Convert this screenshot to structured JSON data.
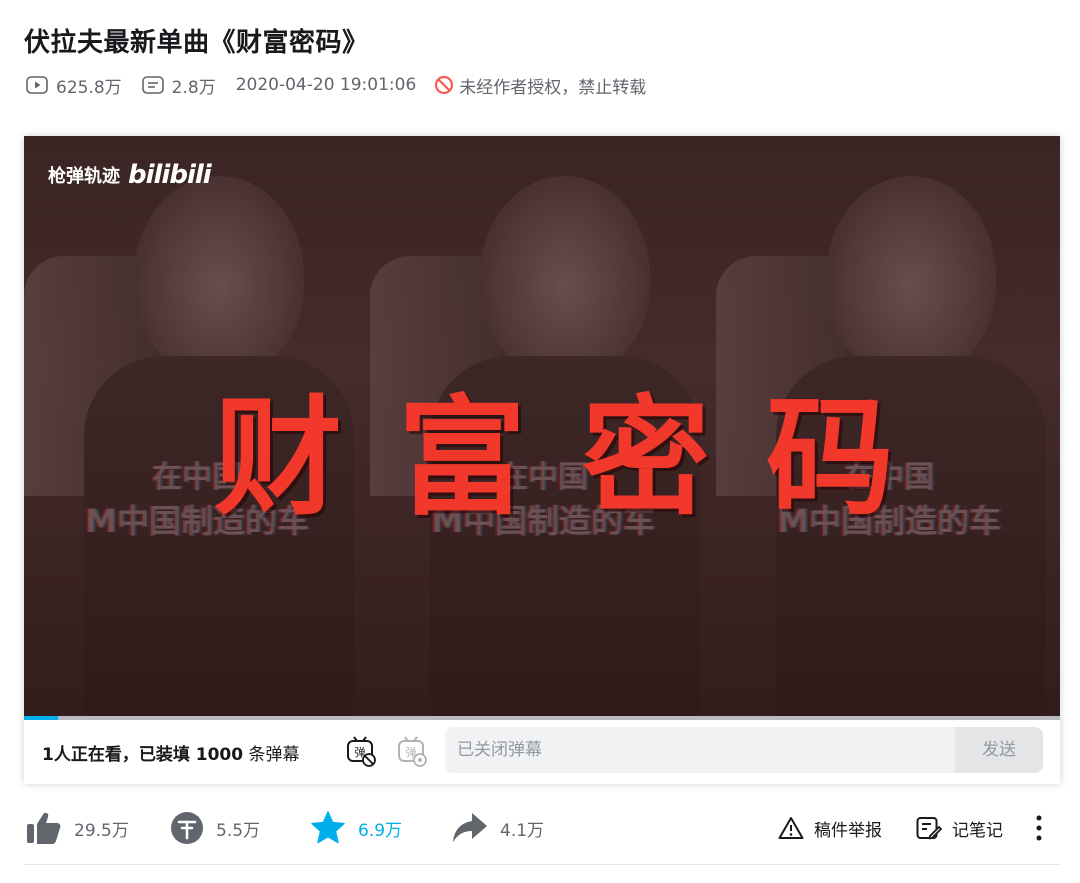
{
  "video": {
    "title": "伏拉夫最新单曲《财富密码》",
    "play_count": "625.8万",
    "danmaku_count": "2.8万",
    "publish_time": "2020-04-20 19:01:06",
    "copyright_notice": "未经作者授权，禁止转载"
  },
  "player": {
    "watermark_text": "枪弹轨迹",
    "watermark_logo": "bilibili",
    "overlay_title_chars": [
      "财",
      "富",
      "密",
      "码"
    ],
    "subtitle_line1": "在中国",
    "subtitle_line2": "M中国制造的车",
    "progress_fraction": 0.033
  },
  "danmaku_bar": {
    "viewers_prefix": "1人正在看，已装填 ",
    "loaded_count": "1000",
    "viewers_suffix": " 条弹幕",
    "input_placeholder": "已关闭弹幕",
    "send_label": "发送"
  },
  "toolbar": {
    "like_count": "29.5万",
    "coin_count": "5.5万",
    "favorite_count": "6.9万",
    "share_count": "4.1万",
    "report_label": "稿件举报",
    "note_label": "记笔记"
  },
  "colors": {
    "accent": "#00aeec",
    "title_red": "#f2372b",
    "muted_text": "#61666d",
    "forbid_red": "#f85a54"
  },
  "icons": {
    "play": "play-count-icon",
    "danmaku": "danmaku-count-icon",
    "forbid": "no-reprint-icon",
    "like": "thumbs-up-icon",
    "coin": "coin-icon",
    "favorite": "star-icon",
    "share": "share-arrow-icon",
    "report": "warning-triangle-icon",
    "note": "note-pen-icon",
    "more": "vertical-dots-icon"
  }
}
